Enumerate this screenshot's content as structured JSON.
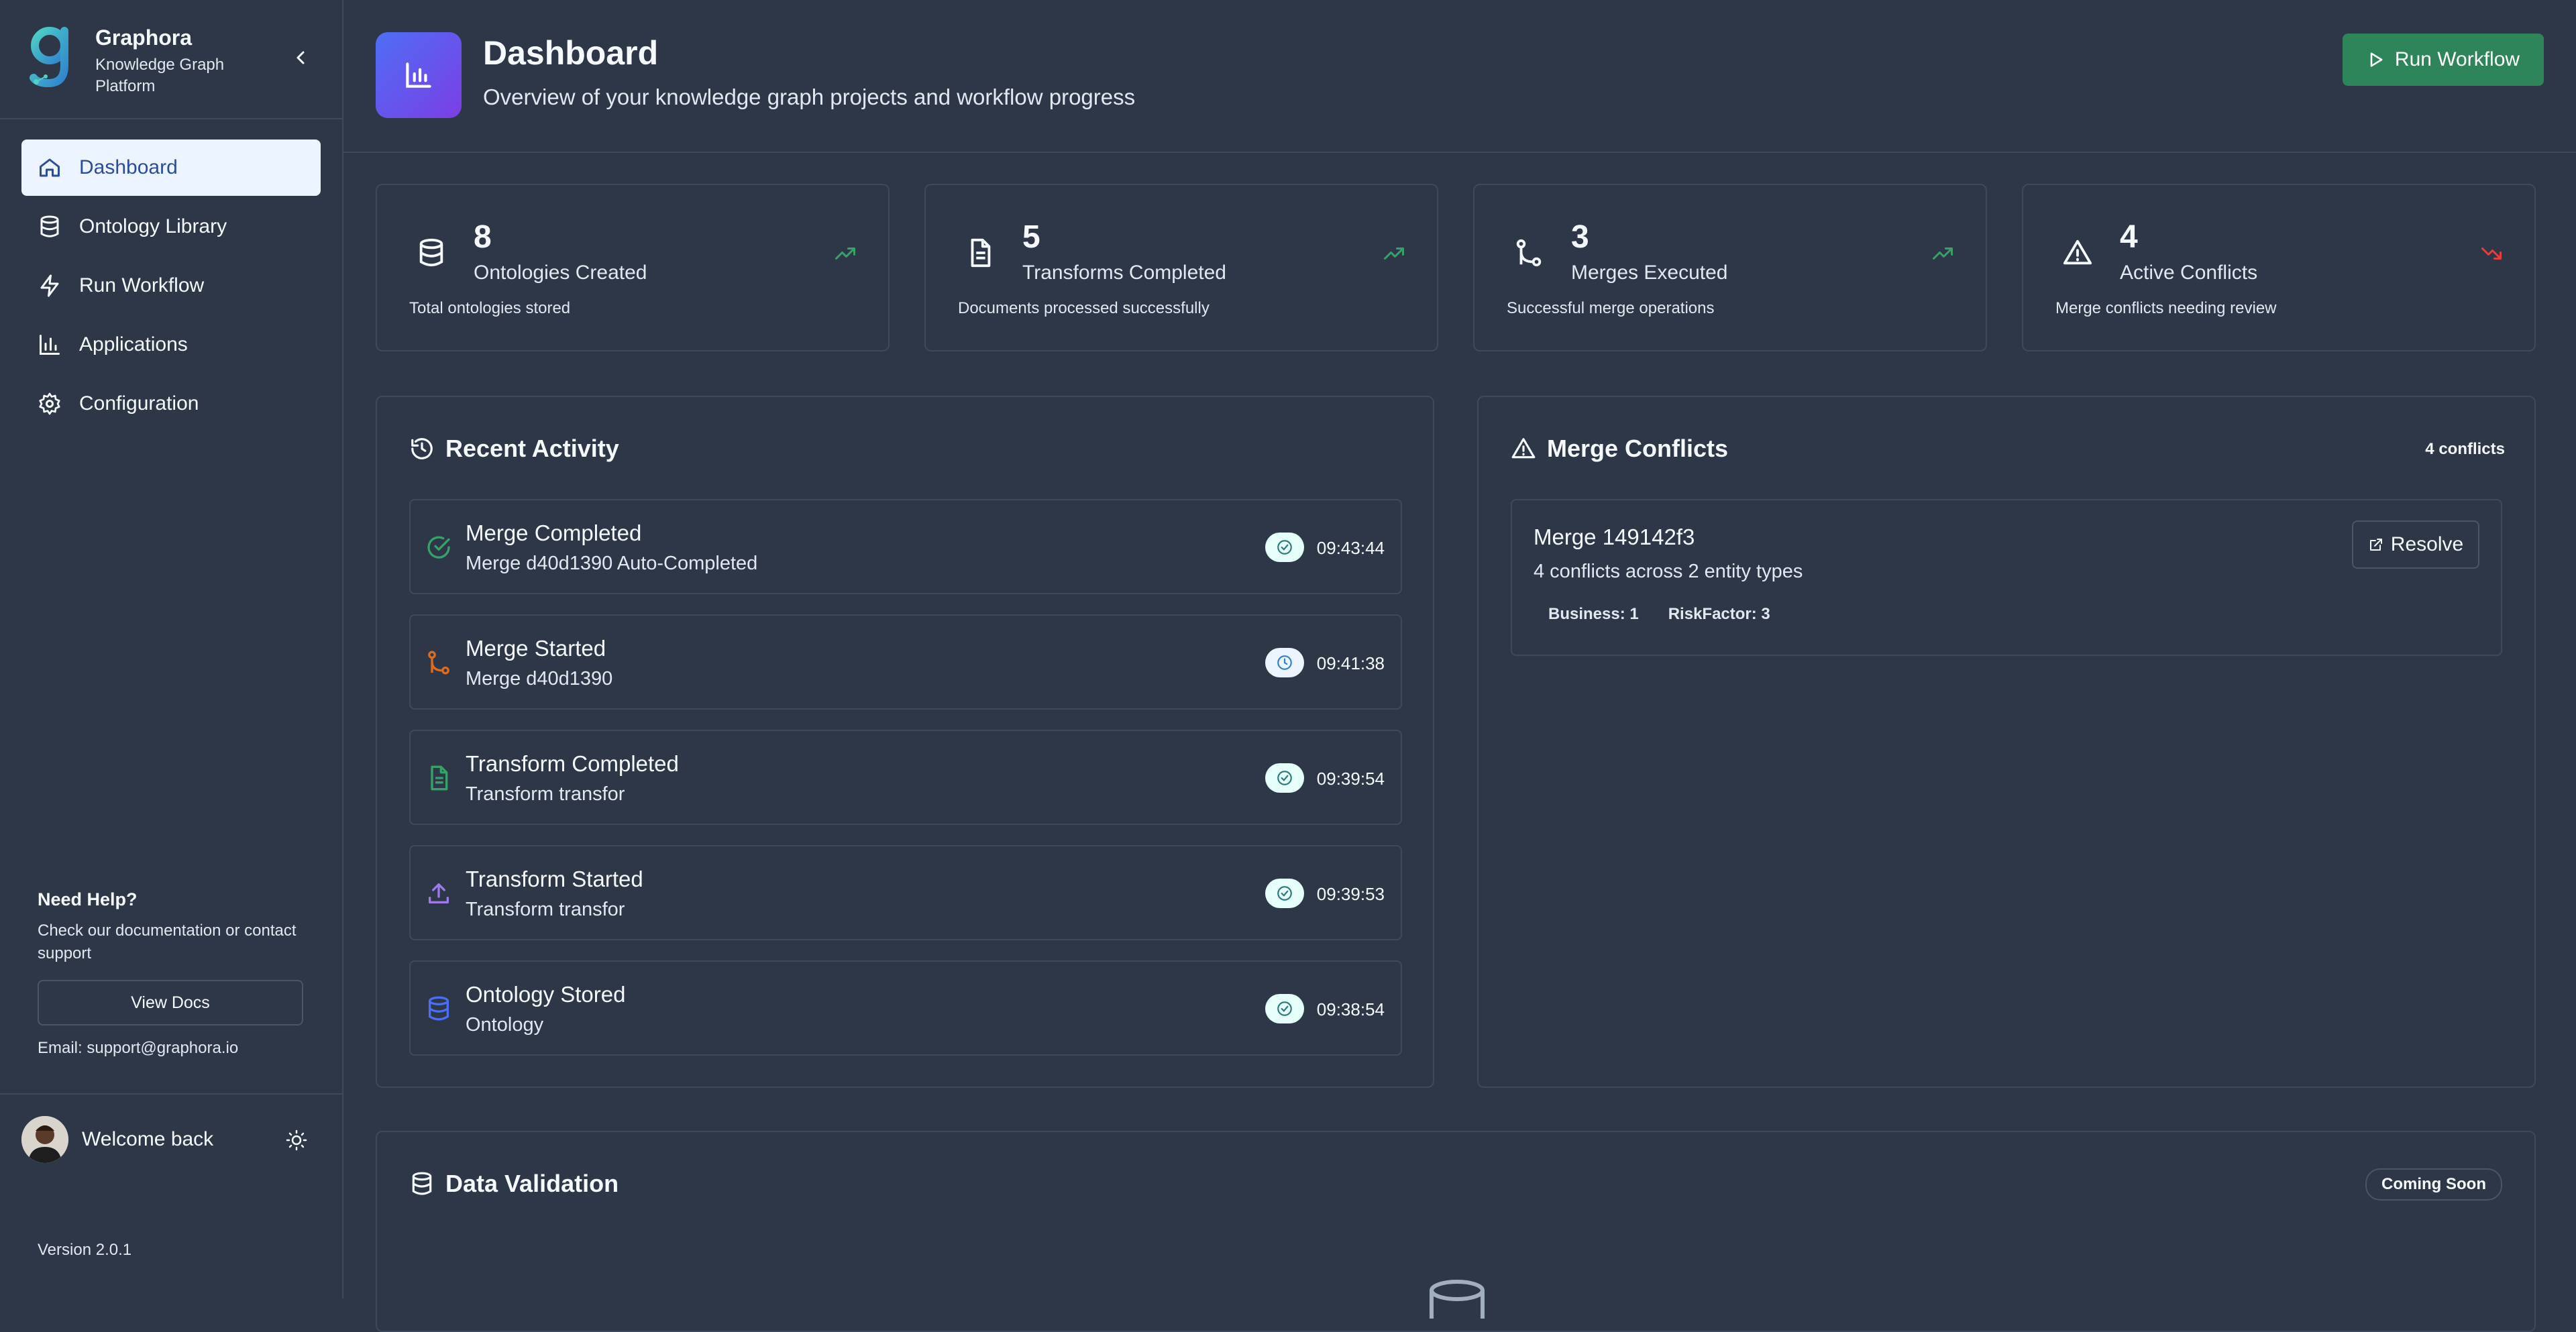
{
  "sidebar": {
    "brand_title": "Graphora",
    "brand_subtitle": "Knowledge Graph Platform",
    "nav": [
      {
        "label": "Dashboard",
        "icon": "home-icon",
        "active": true
      },
      {
        "label": "Ontology Library",
        "icon": "database-icon"
      },
      {
        "label": "Run Workflow",
        "icon": "lightning-icon"
      },
      {
        "label": "Applications",
        "icon": "bar-chart-icon"
      },
      {
        "label": "Configuration",
        "icon": "gear-icon"
      }
    ],
    "help_title": "Need Help?",
    "help_text": "Check our documentation or contact support",
    "docs_button": "View Docs",
    "email": "Email: support@graphora.io",
    "welcome": "Welcome back",
    "version": "Version 2.0.1"
  },
  "header": {
    "title": "Dashboard",
    "subtitle": "Overview of your knowledge graph projects and workflow progress",
    "run_button": "Run Workflow"
  },
  "stats": [
    {
      "value": "8",
      "label": "Ontologies Created",
      "desc": "Total ontologies stored",
      "trend": "up"
    },
    {
      "value": "5",
      "label": "Transforms Completed",
      "desc": "Documents processed successfully",
      "trend": "up"
    },
    {
      "value": "3",
      "label": "Merges Executed",
      "desc": "Successful merge operations",
      "trend": "up"
    },
    {
      "value": "4",
      "label": "Active Conflicts",
      "desc": "Merge conflicts needing review",
      "trend": "down"
    }
  ],
  "activity": {
    "title": "Recent Activity",
    "items": [
      {
        "title": "Merge Completed",
        "sub": "Merge d40d1390 Auto-Completed",
        "time": "09:43:44",
        "status": "done"
      },
      {
        "title": "Merge Started",
        "sub": "Merge d40d1390",
        "time": "09:41:38",
        "status": "pending"
      },
      {
        "title": "Transform Completed",
        "sub": "Transform transfor",
        "time": "09:39:54",
        "status": "done"
      },
      {
        "title": "Transform Started",
        "sub": "Transform transfor",
        "time": "09:39:53",
        "status": "done"
      },
      {
        "title": "Ontology Stored",
        "sub": "Ontology",
        "time": "09:38:54",
        "status": "done"
      }
    ]
  },
  "conflicts": {
    "title": "Merge Conflicts",
    "count": "4 conflicts",
    "card_title": "Merge 149142f3",
    "card_sub": "4 conflicts across 2 entity types",
    "tags": [
      "Business: 1",
      "RiskFactor: 3"
    ],
    "resolve": "Resolve"
  },
  "validation": {
    "title": "Data Validation",
    "badge": "Coming Soon"
  },
  "colors": {
    "background": "#2d3748",
    "accent_green": "#2f855a",
    "trend_up": "#38a169",
    "trend_down": "#e53e3e",
    "active_nav": "#ebf4ff"
  }
}
